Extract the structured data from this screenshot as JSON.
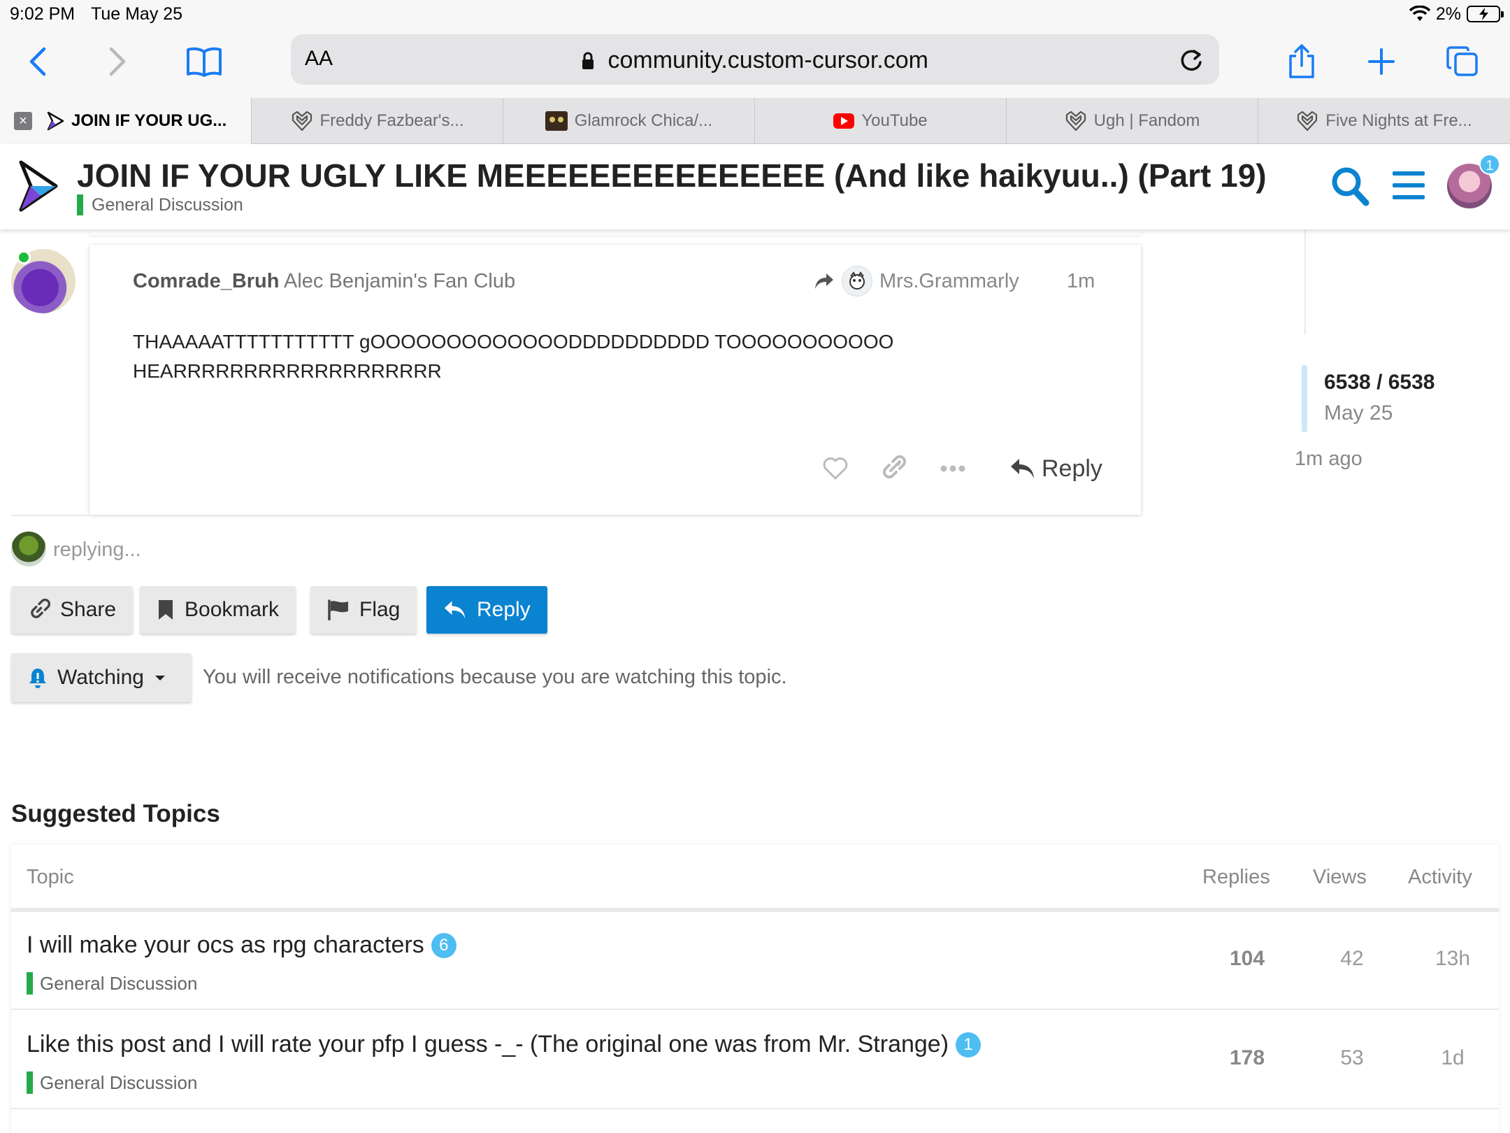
{
  "status_bar": {
    "time": "9:02 PM",
    "date": "Tue May 25",
    "battery": "2%"
  },
  "browser": {
    "url_aa": "AA",
    "url": "community.custom-cursor.com",
    "tabs": [
      {
        "label": "JOIN IF YOUR UG...",
        "icon": "custom-cursor-logo-icon"
      },
      {
        "label": "Freddy Fazbear's...",
        "icon": "fandom-heart-icon"
      },
      {
        "label": "Glamrock Chica/...",
        "icon": "image-favicon-icon"
      },
      {
        "label": "YouTube",
        "icon": "youtube-icon"
      },
      {
        "label": "Ugh | Fandom",
        "icon": "fandom-heart-icon"
      },
      {
        "label": "Five Nights at Fre...",
        "icon": "fandom-heart-icon"
      }
    ]
  },
  "header": {
    "title": "JOIN IF YOUR UGLY LIKE MEEEEEEEEEEEEEEE (And like haikyuu..) (Part 19)",
    "category": "General Discussion",
    "notification_count": "1"
  },
  "post": {
    "username": "Comrade_Bruh",
    "flair": "Alec Benjamin's Fan Club",
    "reply_to": "Mrs.Grammarly",
    "time": "1m",
    "body_line1": "THAAAAATTTTTTTTTTT gOOOOOOOOOOOOODDDDDDDDDD TOOOOOOOOOOO",
    "body_line2": "HEARRRRRRRRRRRRRRRRRRR",
    "reply_label": "Reply"
  },
  "timeline": {
    "count": "6538 / 6538",
    "date": "May 25",
    "ago": "1m ago"
  },
  "replying": "replying...",
  "footer_buttons": {
    "share": "Share",
    "bookmark": "Bookmark",
    "flag": "Flag",
    "reply": "Reply"
  },
  "notifications": {
    "level": "Watching",
    "text": "You will receive notifications because you are watching this topic."
  },
  "suggested": {
    "title": "Suggested Topics",
    "columns": {
      "topic": "Topic",
      "replies": "Replies",
      "views": "Views",
      "activity": "Activity"
    },
    "rows": [
      {
        "title": "I will make your ocs as rpg characters",
        "badge": "6",
        "category": "General Discussion",
        "replies": "104",
        "views": "42",
        "activity": "13h"
      },
      {
        "title": "Like this post and I will rate your pfp I guess -_- (The original one was from Mr. Strange)",
        "badge": "1",
        "category": "General Discussion",
        "replies": "178",
        "views": "53",
        "activity": "1d"
      }
    ]
  },
  "colors": {
    "accent": "#0a83d1",
    "category": "#25aa4a",
    "badge": "#4ebdf2"
  }
}
